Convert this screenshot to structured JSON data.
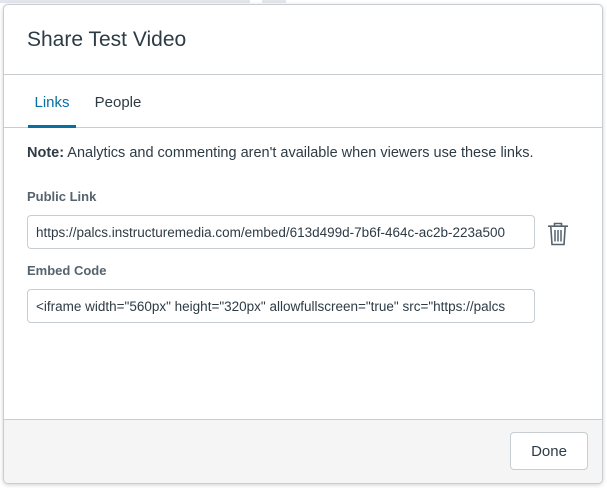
{
  "modal": {
    "title": "Share Test Video"
  },
  "tabs": [
    {
      "label": "Links",
      "active": true
    },
    {
      "label": "People",
      "active": false
    }
  ],
  "note": {
    "prefix": "Note:",
    "text": " Analytics and commenting aren't available when viewers use these links."
  },
  "public_link": {
    "label": "Public Link",
    "value": "https://palcs.instructuremedia.com/embed/613d499d-7b6f-464c-ac2b-223a500"
  },
  "embed_code": {
    "label": "Embed Code",
    "value": "<iframe width=\"560px\" height=\"320px\" allowfullscreen=\"true\" src=\"https://palcs"
  },
  "icons": {
    "delete_link": "trash-icon"
  },
  "footer": {
    "done_label": "Done"
  },
  "colors": {
    "accent": "#0770a3",
    "text": "#2d3b45",
    "label": "#56636d",
    "border": "#c7cdd1",
    "footer_bg": "#f5f5f5"
  }
}
